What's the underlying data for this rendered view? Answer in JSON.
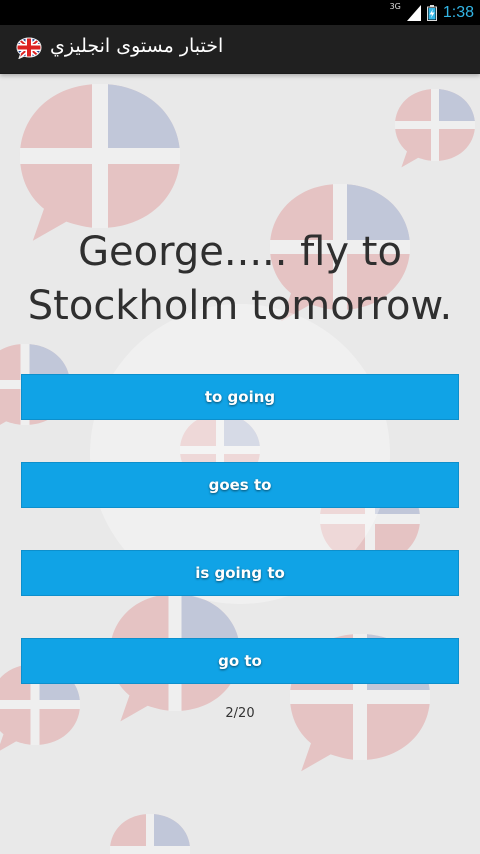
{
  "status_bar": {
    "network": "3G",
    "time": "1:38",
    "signal_icon": "signal-bars-icon",
    "battery_icon": "battery-charging-icon"
  },
  "app_bar": {
    "title": "اختبار مستوى انجليزي",
    "flag_icon": "uk-flag-icon"
  },
  "quiz": {
    "question": "George..... fly to Stockholm tomorrow.",
    "answers": [
      "to going",
      "goes to",
      "is going to",
      "go to"
    ],
    "progress": "2/20"
  },
  "colors": {
    "button": "#10a3e6",
    "accent_clock": "#33b5e5",
    "action_bar": "#202020"
  }
}
